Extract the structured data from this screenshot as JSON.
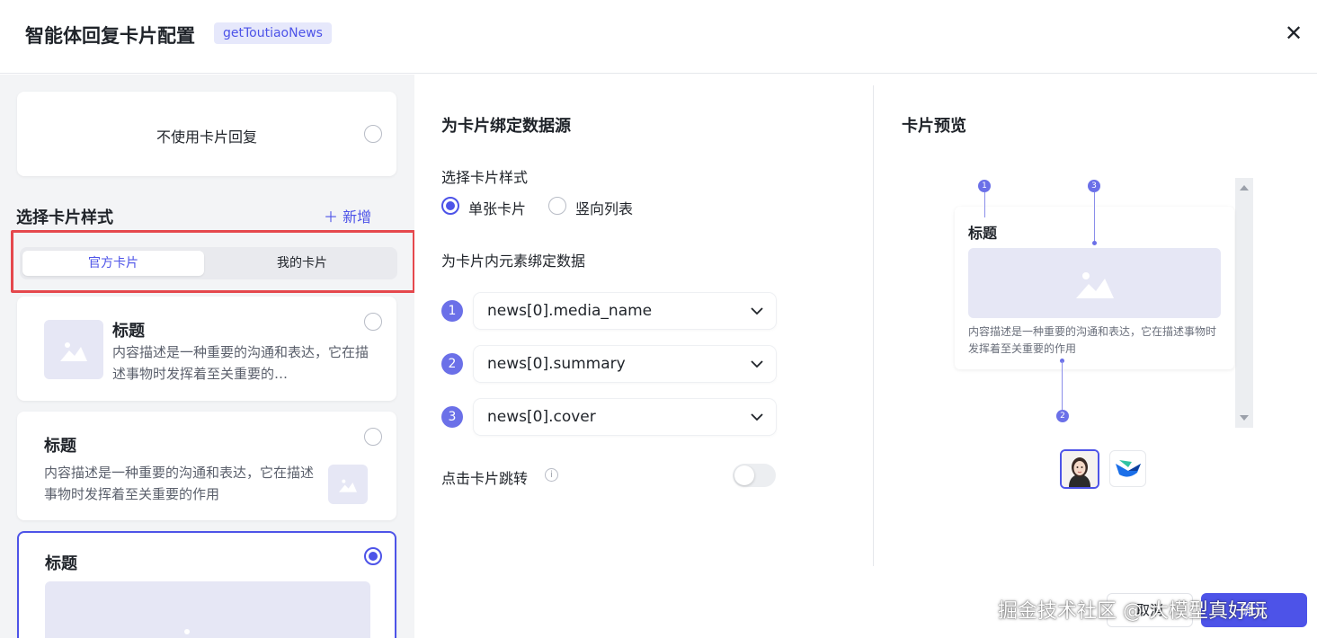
{
  "header": {
    "title": "智能体回复卡片配置",
    "tag": "getToutiaoNews",
    "close_symbol": "✕"
  },
  "left": {
    "no_card_label": "不使用卡片回复",
    "section_title": "选择卡片样式",
    "add_label": "＋ 新增",
    "tabs": [
      {
        "label": "官方卡片",
        "active": true
      },
      {
        "label": "我的卡片",
        "active": false
      }
    ],
    "cards": [
      {
        "title": "标题",
        "desc": "内容描述是一种重要的沟通和表达，它在描述事物时发挥着至关重要的…",
        "selected": false
      },
      {
        "title": "标题",
        "desc": "内容描述是一种重要的沟通和表达，它在描述事物时发挥着至关重要的作用",
        "selected": false
      },
      {
        "title": "标题",
        "selected": true
      }
    ]
  },
  "middle": {
    "title": "为卡片绑定数据源",
    "style_label": "选择卡片样式",
    "style_options": [
      {
        "label": "单张卡片",
        "selected": true
      },
      {
        "label": "竖向列表",
        "selected": false
      }
    ],
    "bind_title": "为卡片内元素绑定数据",
    "bindings": [
      {
        "num": "1",
        "value": "news[0].media_name"
      },
      {
        "num": "2",
        "value": "news[0].summary"
      },
      {
        "num": "3",
        "value": "news[0].cover"
      }
    ],
    "jump_label": "点击卡片跳转",
    "jump_enabled": false
  },
  "preview": {
    "title": "卡片预览",
    "card_title": "标题",
    "card_desc": "内容描述是一种重要的沟通和表达，它在描述事物时发挥着至关重要的作用",
    "pins": [
      "1",
      "3",
      "2"
    ]
  },
  "footer": {
    "cancel": "取消",
    "confirm": "确认",
    "watermark": "掘金技术社区 @ 大模型真好玩"
  },
  "colors": {
    "accent": "#4d53e8",
    "highlight": "#e5484d"
  },
  "icons": {
    "close": "close-icon",
    "image": "image-placeholder-icon",
    "chevron": "chevron-down-icon",
    "info": "info-icon"
  }
}
